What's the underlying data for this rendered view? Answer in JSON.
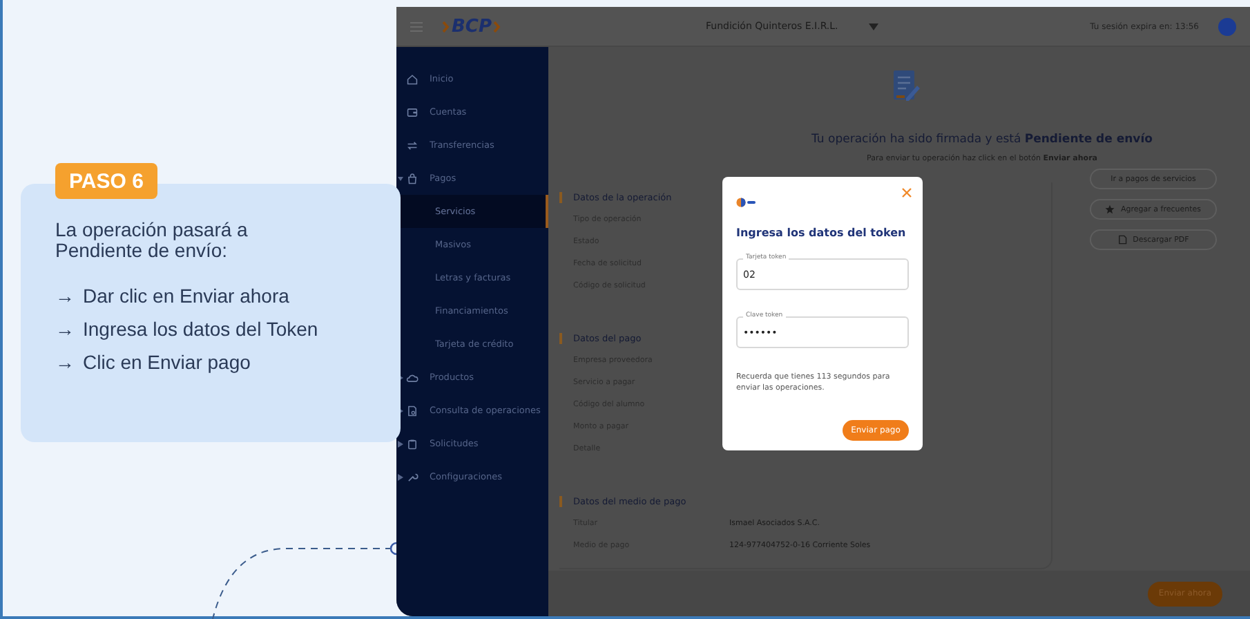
{
  "tutorial": {
    "step_badge": "PASO 6",
    "description": "La operación pasará a Pendiente de envío:",
    "steps": [
      {
        "marker": "→",
        "text": "Dar clic en Enviar ahora"
      },
      {
        "marker": "→",
        "text": "Ingresa los datos del Token"
      },
      {
        "marker": "→",
        "text": "Clic en Enviar pago"
      }
    ]
  },
  "app": {
    "header": {
      "logo": "BCP",
      "company": "Fundición Quinteros E.I.R.L.",
      "session": "Tu sesión expira en: 13:56"
    },
    "sidebar": {
      "items": [
        {
          "label": "Inicio"
        },
        {
          "label": "Cuentas"
        },
        {
          "label": "Transferencias"
        },
        {
          "label": "Pagos",
          "expanded": true,
          "children": [
            {
              "label": "Servicios",
              "selected": true
            },
            {
              "label": "Masivos",
              "selected": false
            },
            {
              "label": "Letras y facturas",
              "selected": false
            },
            {
              "label": "Financiamientos",
              "selected": false
            },
            {
              "label": "Tarjeta de crédito",
              "selected": false
            }
          ]
        },
        {
          "label": "Productos",
          "expanded": false
        },
        {
          "label": "Consulta de operaciones",
          "expanded": false
        },
        {
          "label": "Solicitudes",
          "expanded": false
        },
        {
          "label": "Configuraciones",
          "expanded": false
        }
      ]
    },
    "status_title": "Tu operación ha sido firmada y está **Pendiente de envío**",
    "status_hint": "Para enviar tu operación haz click en el botón **Enviar ahora**",
    "sections": [
      {
        "title": "Datos de la operación",
        "rows": [
          {
            "label": "Tipo de operación"
          },
          {
            "label": "Estado"
          },
          {
            "label": "Fecha de solicitud"
          },
          {
            "label": "Código de solicitud"
          }
        ]
      },
      {
        "title": "Datos del pago",
        "rows": [
          {
            "label": "Empresa proveedora"
          },
          {
            "label": "Servicio a pagar"
          },
          {
            "label": "Código del alumno"
          },
          {
            "label": "Monto a pagar"
          },
          {
            "label": "Detalle"
          }
        ]
      },
      {
        "title": "Datos del medio de pago",
        "rows": [
          {
            "label": "Titular",
            "value": "Ismael Asociados S.A.C."
          },
          {
            "label": "Medio de pago",
            "value": "124-977404752-0-16 Corriente Soles"
          }
        ]
      }
    ],
    "actions": [
      {
        "label": "Ir a pagos de servicios"
      },
      {
        "label": "Agregar a frecuentes"
      },
      {
        "label": "Descargar PDF"
      }
    ],
    "footer_button": "Enviar ahora",
    "modal": {
      "title": "Ingresa los datos del token",
      "fields": [
        {
          "label": "Tarjeta token",
          "value": "02"
        },
        {
          "label": "Clave token",
          "value": "••••••"
        }
      ],
      "note": "Recuerda que tienes 113 segundos para enviar las operaciones.",
      "button": "Enviar pago"
    }
  }
}
